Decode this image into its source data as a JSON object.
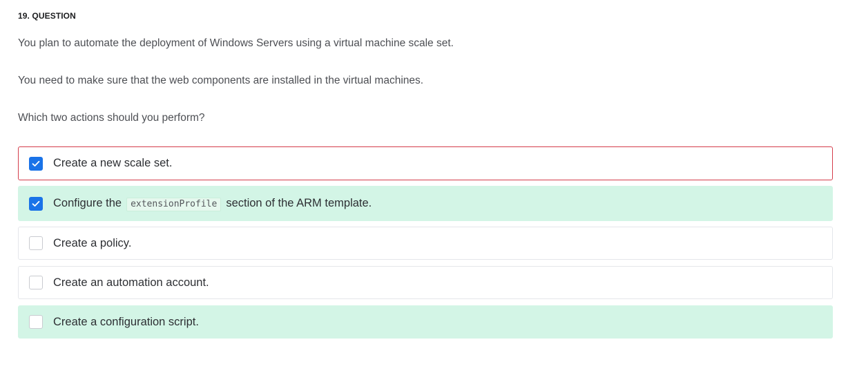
{
  "question": {
    "header": "19. QUESTION",
    "paragraphs": [
      "You plan to automate the deployment of Windows Servers using a virtual machine scale set.",
      "You need to make sure that the web components are installed in the virtual machines.",
      "Which two actions should you perform?"
    ]
  },
  "options": [
    {
      "text": "Create a new scale set.",
      "checked": true,
      "state": "selected-incorrect"
    },
    {
      "text_before": "Configure the",
      "code": "extensionProfile",
      "text_after": "section of the ARM template.",
      "checked": true,
      "state": "correct"
    },
    {
      "text": "Create a policy.",
      "checked": false,
      "state": "neutral"
    },
    {
      "text": "Create an automation account.",
      "checked": false,
      "state": "neutral"
    },
    {
      "text": "Create a configuration script.",
      "checked": false,
      "state": "correct"
    }
  ],
  "colors": {
    "checkbox_checked": "#1a73e8",
    "incorrect_border": "#d43c4a",
    "correct_background": "#d3f5e6"
  }
}
